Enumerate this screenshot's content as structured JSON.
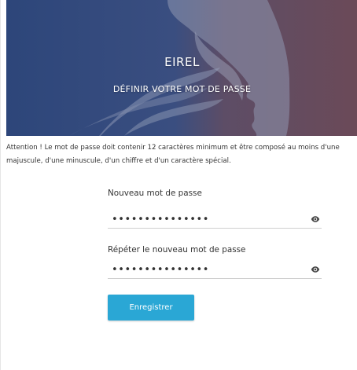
{
  "banner": {
    "title": "EIREL",
    "subtitle": "DÉFINIR VOTRE MOT DE PASSE"
  },
  "notice": {
    "text": "Attention ! Le mot de passe doit contenir 12 caractères minimum et être composé au moins d'une majuscule, d'une minuscule, d'un chiffre et d'un caractère spécial."
  },
  "form": {
    "new_password_label": "Nouveau mot de passe",
    "new_password_value": "•••••••••••••••",
    "repeat_password_label": "Répéter le nouveau mot de passe",
    "repeat_password_value": "•••••••••••••••",
    "submit_label": "Enregistrer"
  },
  "icons": {
    "toggle_visibility": "eye-icon"
  },
  "colors": {
    "banner_blue": "#2f4a79",
    "banner_red": "#6b4a58",
    "button": "#2aa7d5"
  }
}
